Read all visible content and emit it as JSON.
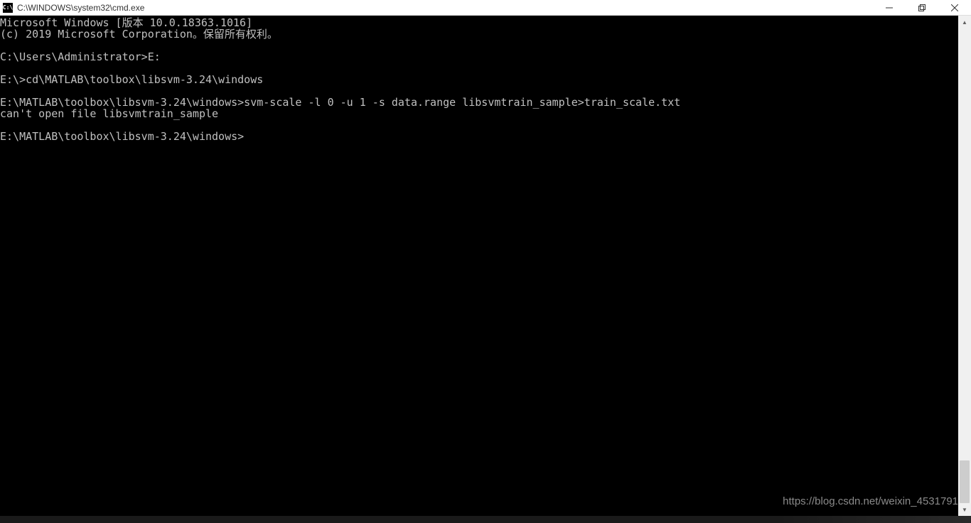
{
  "titlebar": {
    "icon_text": "C:\\",
    "title": "C:\\WINDOWS\\system32\\cmd.exe"
  },
  "terminal": {
    "lines": [
      "Microsoft Windows [版本 10.0.18363.1016]",
      "(c) 2019 Microsoft Corporation。保留所有权利。",
      "",
      "C:\\Users\\Administrator>E:",
      "",
      "E:\\>cd\\MATLAB\\toolbox\\libsvm-3.24\\windows",
      "",
      "E:\\MATLAB\\toolbox\\libsvm-3.24\\windows>svm-scale -l 0 -u 1 -s data.range libsvmtrain_sample>train_scale.txt",
      "can't open file libsvmtrain_sample",
      "",
      "E:\\MATLAB\\toolbox\\libsvm-3.24\\windows>"
    ]
  },
  "watermark": "https://blog.csdn.net/weixin_4531791"
}
